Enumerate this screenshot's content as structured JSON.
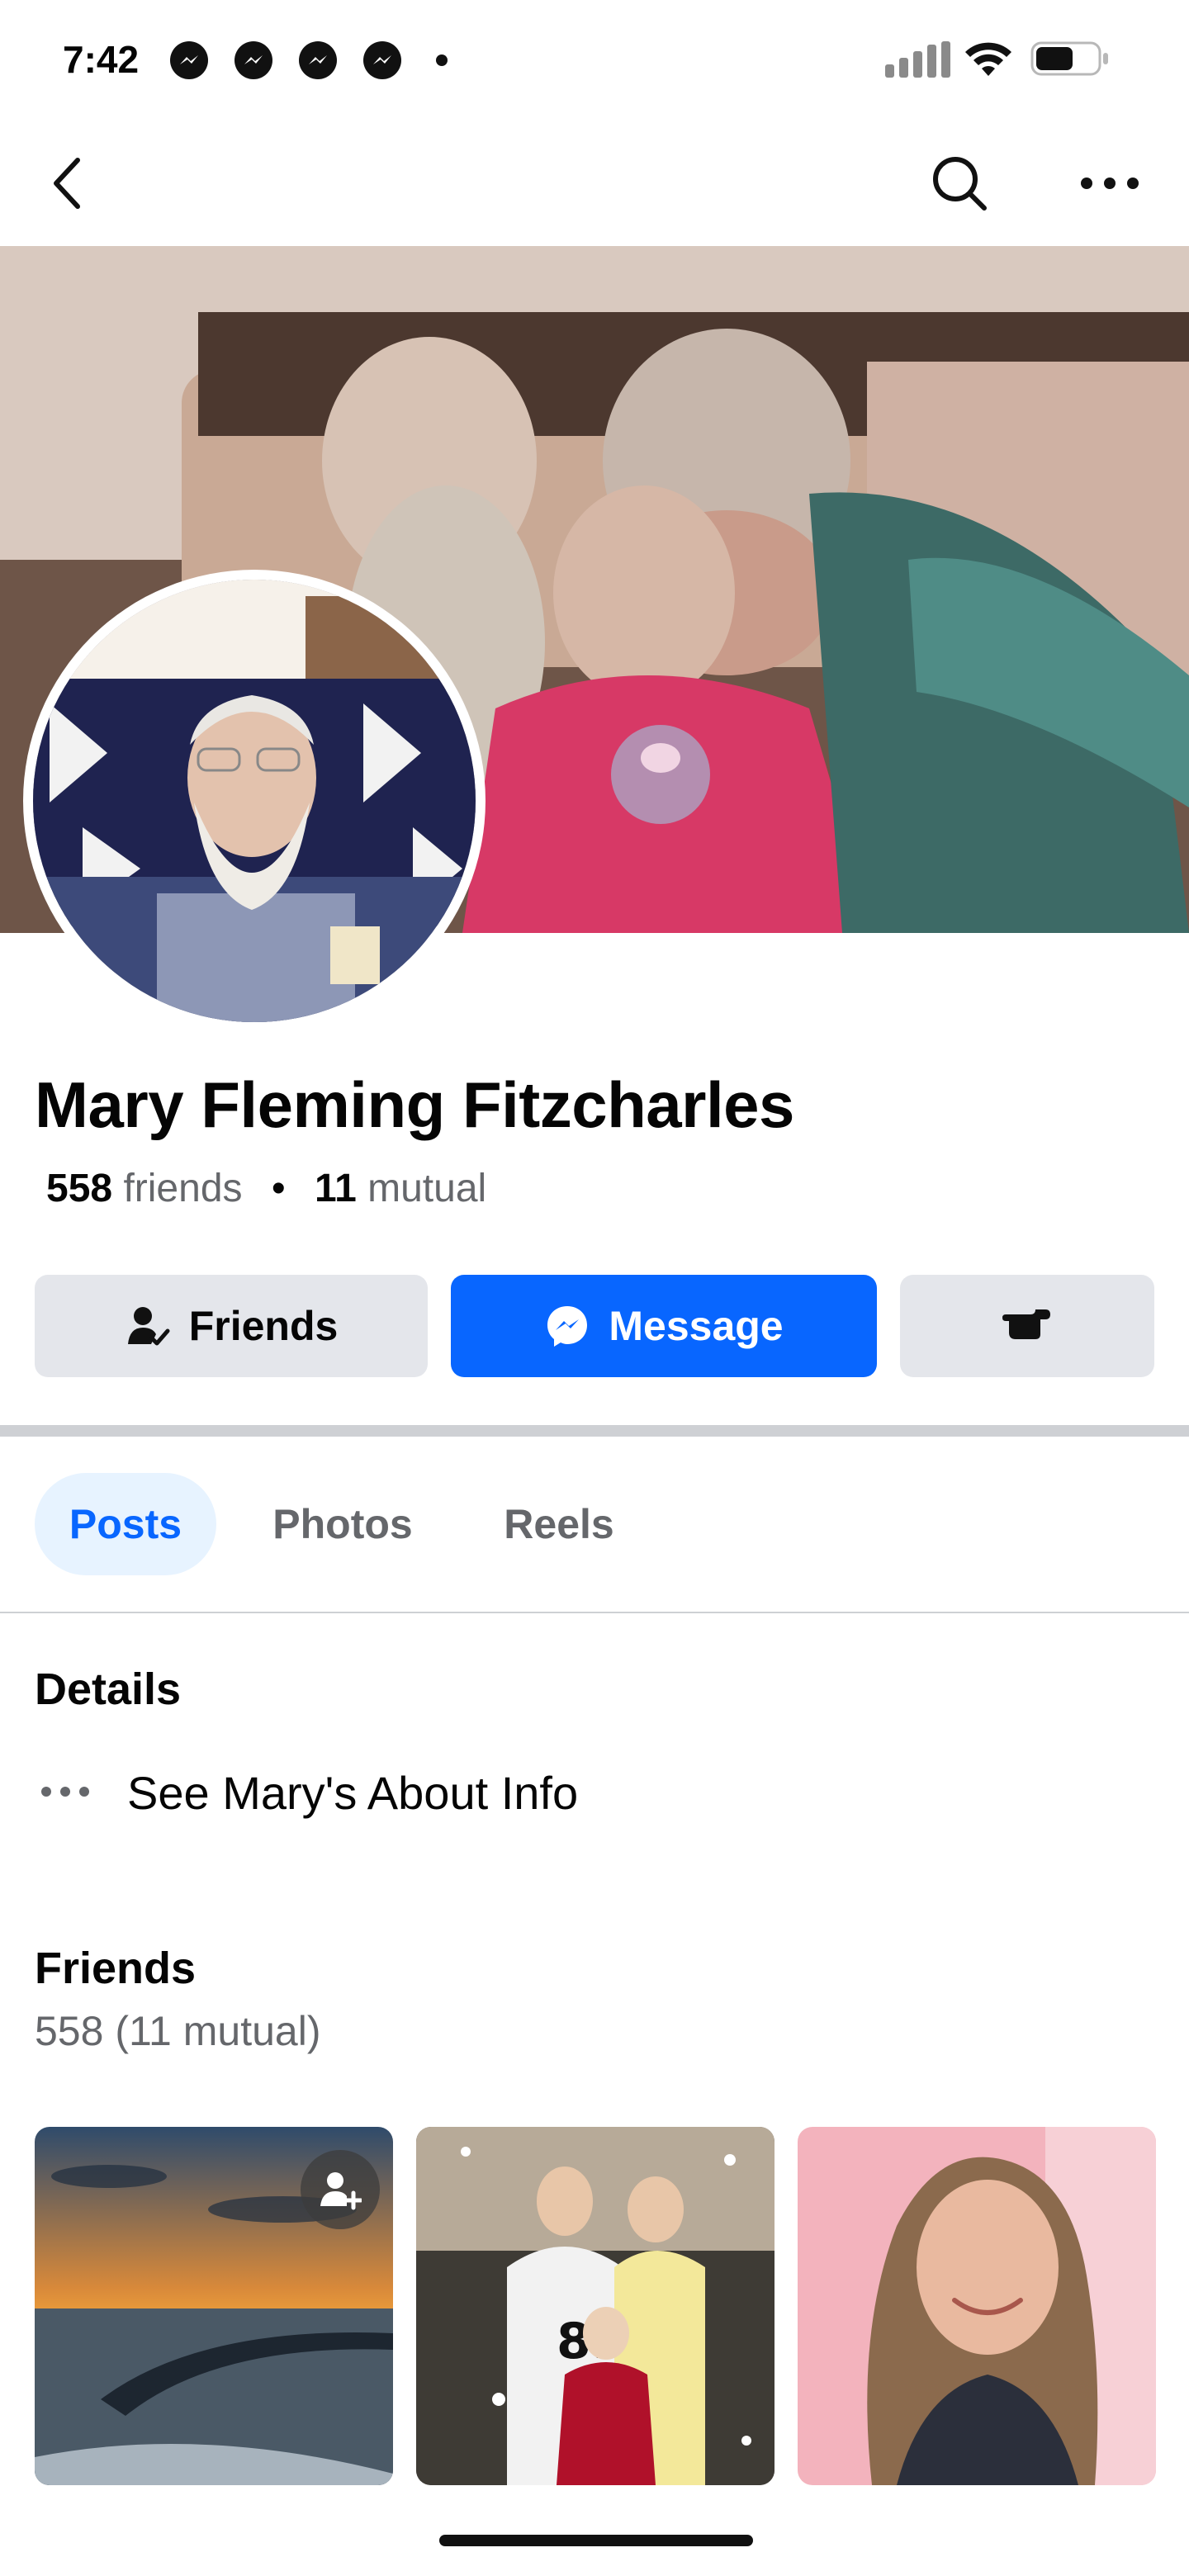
{
  "status_bar": {
    "time": "7:42",
    "notification_icons": [
      "messenger-icon",
      "messenger-icon",
      "messenger-icon",
      "messenger-icon"
    ],
    "battery_level": 0.55
  },
  "nav": {
    "back_icon": "chevron-left-icon",
    "search_icon": "search-icon",
    "more_icon": "more-horizontal-icon"
  },
  "profile": {
    "name": "Mary Fleming Fitzcharles",
    "friends_count": "558",
    "friends_label": "friends",
    "separator": "•",
    "mutual_count": "11",
    "mutual_label": "mutual"
  },
  "actions": {
    "friends_label": "Friends",
    "message_label": "Message",
    "poke_icon": "poke-hand-icon"
  },
  "tabs": [
    {
      "label": "Posts",
      "active": true
    },
    {
      "label": "Photos",
      "active": false
    },
    {
      "label": "Reels",
      "active": false
    }
  ],
  "details": {
    "title": "Details",
    "about_link": "See Mary's About Info"
  },
  "friends_section": {
    "title": "Friends",
    "count_text": "558 (11 mutual)"
  },
  "colors": {
    "accent": "#0866ff",
    "button_gray": "#e4e6eb",
    "tab_active_bg": "#e7f3ff",
    "secondary_text": "#65676b"
  }
}
